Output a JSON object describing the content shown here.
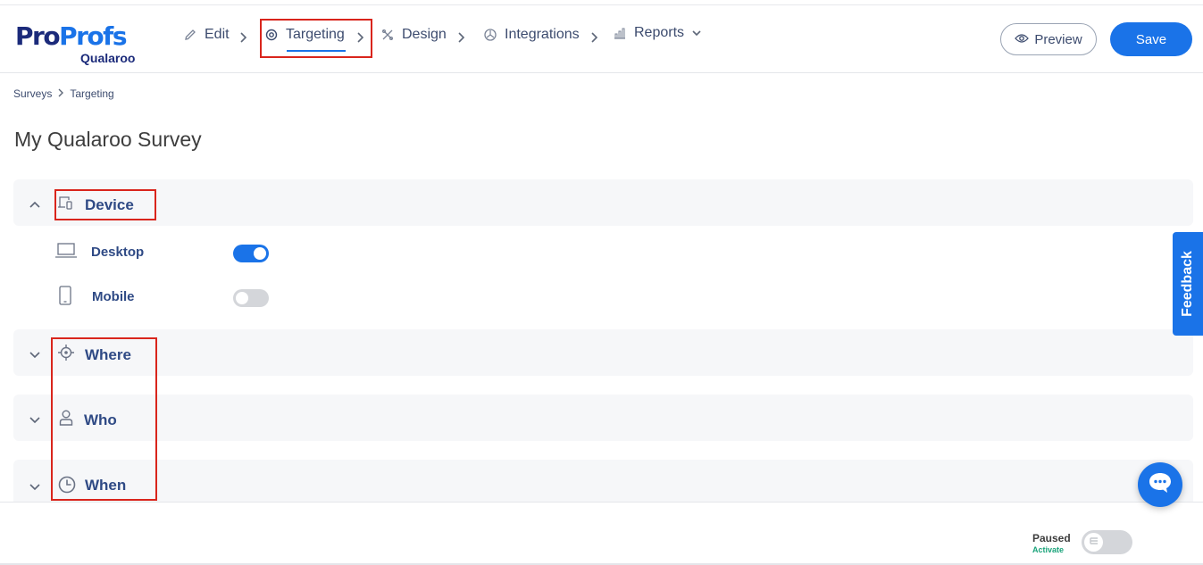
{
  "brand": {
    "name_part1": "Pro",
    "name_part2": "Profs",
    "product": "Qualaroo"
  },
  "nav": {
    "items": [
      {
        "label": "Edit",
        "icon": "pencil-icon"
      },
      {
        "label": "Targeting",
        "icon": "target-gear-icon",
        "active": true
      },
      {
        "label": "Design",
        "icon": "design-tools-icon"
      },
      {
        "label": "Integrations",
        "icon": "integrations-icon"
      },
      {
        "label": "Reports",
        "icon": "bar-chart-icon"
      }
    ]
  },
  "actions": {
    "preview_label": "Preview",
    "save_label": "Save"
  },
  "breadcrumb": {
    "items": [
      "Surveys",
      "Targeting"
    ]
  },
  "page": {
    "title": "My Qualaroo Survey"
  },
  "sections": {
    "device": {
      "label": "Device",
      "expanded": true
    },
    "where": {
      "label": "Where",
      "expanded": false
    },
    "who": {
      "label": "Who",
      "expanded": false
    },
    "when": {
      "label": "When",
      "expanded": false
    }
  },
  "devices": [
    {
      "label": "Desktop",
      "enabled": true
    },
    {
      "label": "Mobile",
      "enabled": false
    }
  ],
  "feedback_tab": {
    "label": "Feedback"
  },
  "status": {
    "label": "Paused",
    "action": "Activate"
  },
  "colors": {
    "accent": "#1a73e8",
    "highlight": "#d9251c",
    "activate": "#1aa37a"
  }
}
